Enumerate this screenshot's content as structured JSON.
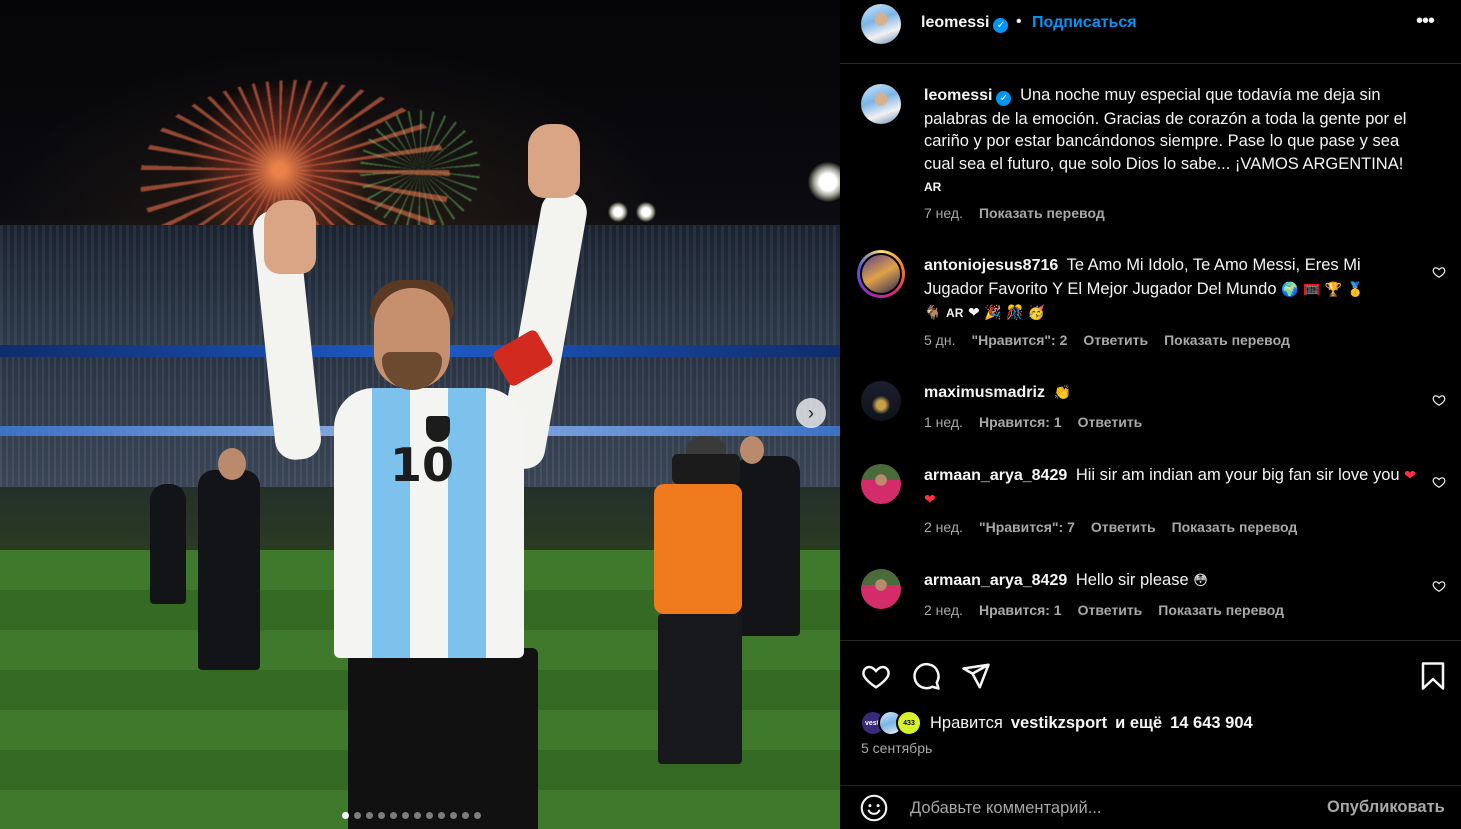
{
  "post": {
    "username": "leomessi",
    "follow_label": "Подписаться",
    "separator": "•",
    "more_icon": "more-horizontal-icon",
    "carousel": {
      "slide_count": 12,
      "active_index": 0
    }
  },
  "caption": {
    "username": "leomessi",
    "text": "Una noche muy especial que todavía me deja sin palabras de la emoción. Gracias de corazón a toda la gente por el cariño y por estar bancándonos siempre. Pase lo que pase y sea cual sea el futuro, que solo Dios lo sabe... ¡VAMOS ARGENTINA!",
    "flag": "AR",
    "time": "7 нед.",
    "translate": "Показать перевод"
  },
  "comments": [
    {
      "username": "antoniojesus8716",
      "text": "Te Amo Mi Idolo, Te Amo Messi, Eres Mi Jugador Favorito Y El Mejor Jugador Del Mundo",
      "emoji_line1": "🌍 🥅 🏆 🥇",
      "emoji_line2_a": "🐐",
      "flag": "AR",
      "emoji_line2_b": "❤ 🎉 🎊 🥳",
      "time": "5 дн.",
      "likes": "\"Нравится\": 2",
      "reply": "Ответить",
      "translate": "Показать перевод"
    },
    {
      "username": "maximusmadriz",
      "text": "👏",
      "time": "1 нед.",
      "likes": "Нравится: 1",
      "reply": "Ответить"
    },
    {
      "username": "armaan_arya_8429",
      "text": "Hii sir am indian am your big fan sir love you",
      "emoji": "❤ ❤",
      "time": "2 нед.",
      "likes": "\"Нравится\": 7",
      "reply": "Ответить",
      "translate": "Показать перевод"
    },
    {
      "username": "armaan_arya_8429",
      "text": "Hello sir please",
      "emoji": "😳",
      "time": "2 нед.",
      "likes": "Нравится: 1",
      "reply": "Ответить",
      "translate": "Показать перевод"
    }
  ],
  "likes_summary": {
    "prefix": "Нравится",
    "user": "vestikzsport",
    "middle": "и ещё",
    "count": "14 643 904",
    "mini_avatars": [
      "vesti",
      "",
      "433"
    ]
  },
  "post_date": "5 сентябрь",
  "composer": {
    "placeholder": "Добавьте комментарий...",
    "publish": "Опубликовать"
  },
  "photo": {
    "jersey_number": "10",
    "next_icon": "chevron-right-icon"
  },
  "colors": {
    "accent_blue": "#0095f6",
    "like_red": "#ff3040",
    "secondary_text": "#a8a8a8",
    "divider": "#262626"
  }
}
